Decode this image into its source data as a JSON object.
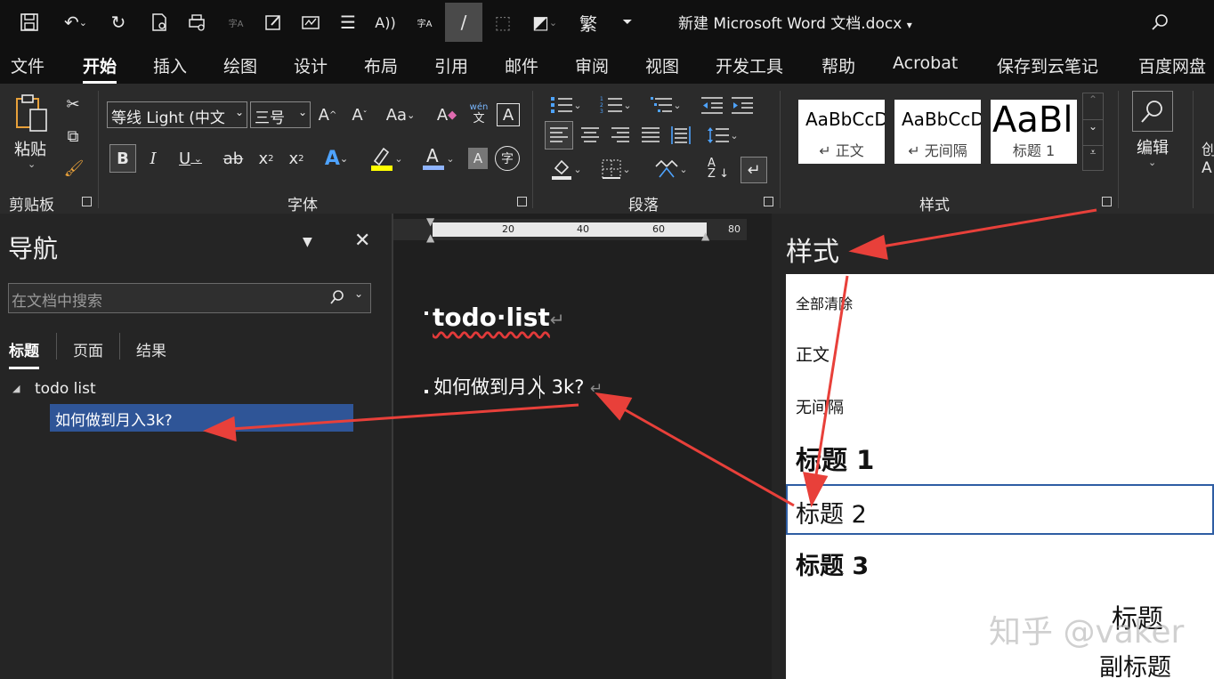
{
  "window": {
    "title": "新建 Microsoft Word 文档.docx"
  },
  "tabs": [
    "文件",
    "开始",
    "插入",
    "绘图",
    "设计",
    "布局",
    "引用",
    "邮件",
    "审阅",
    "视图",
    "开发工具",
    "帮助",
    "Acrobat",
    "保存到云笔记",
    "百度网盘"
  ],
  "ribbon": {
    "clipboard": {
      "paste_label": "粘贴",
      "group_label": "剪贴板"
    },
    "font": {
      "font_name": "等线 Light (中文",
      "font_size": "三号",
      "group_label": "字体",
      "phonetic": "wén"
    },
    "paragraph": {
      "group_label": "段落"
    },
    "styles": {
      "group_label": "样式",
      "tiles": [
        {
          "sample": "AaBbCcDc",
          "caption": "↵ 正文"
        },
        {
          "sample": "AaBbCcDc",
          "caption": "↵ 无间隔"
        },
        {
          "sample": "AaBl",
          "caption": "标题 1"
        }
      ]
    },
    "editing": {
      "label": "编辑"
    }
  },
  "nav": {
    "title": "导航",
    "search_placeholder": "在文档中搜索",
    "tabs": [
      "标题",
      "页面",
      "结果"
    ],
    "tree": [
      {
        "label": "todo list",
        "level": 1
      },
      {
        "label": "如何做到月入3k?",
        "level": 2,
        "selected": true
      }
    ]
  },
  "ruler": {
    "marks": [
      "20",
      "40",
      "60",
      "80"
    ]
  },
  "document": {
    "heading": "todo·list",
    "line2": "如何做到月入 3k?"
  },
  "styles_pane": {
    "title": "样式",
    "items": [
      "全部清除",
      "正文",
      "无间隔",
      "标题 1",
      "标题 2",
      "标题 3",
      "标题",
      "副标题"
    ],
    "selected": "标题 2"
  },
  "watermark": "知乎 @vaker",
  "colors": {
    "accent": "#2e5da3",
    "arrow": "#e8403a",
    "nav_selected": "#2f5597"
  }
}
